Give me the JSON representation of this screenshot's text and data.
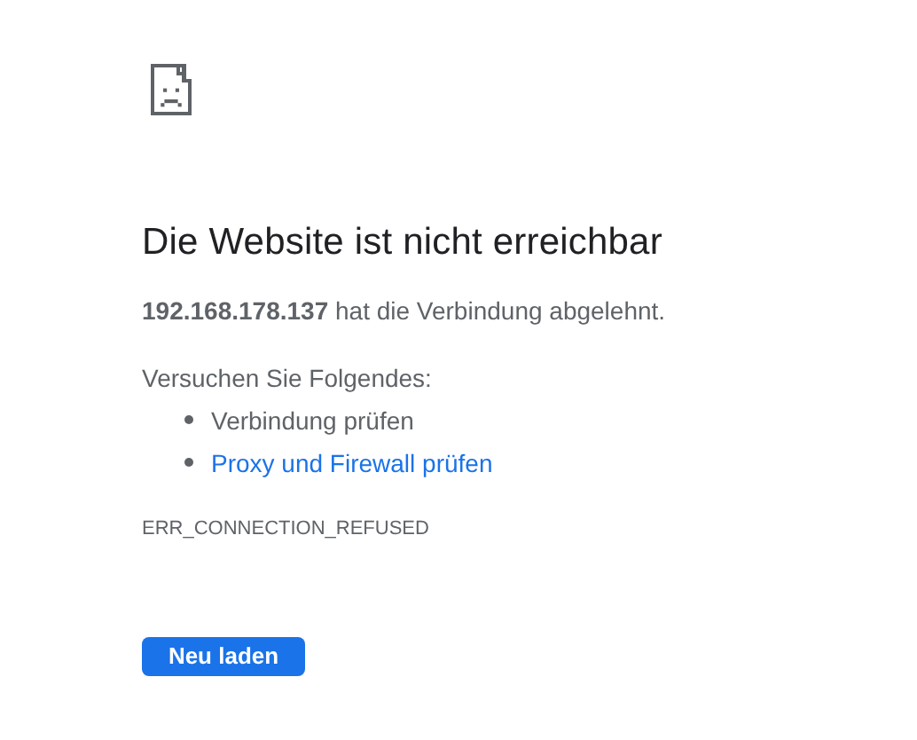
{
  "heading": "Die Website ist nicht erreichbar",
  "message": "**192.168.178.137** hat die Verbindung abgelehnt.",
  "suggestions_title": "Versuchen Sie Folgendes:",
  "suggestions": [
    {
      "kind": "text",
      "label": "Verbindung prüfen"
    },
    {
      "kind": "link",
      "label": "Proxy und Firewall prüfen"
    }
  ],
  "error_code": "ERR_CONNECTION_REFUSED",
  "button": "Neu laden"
}
